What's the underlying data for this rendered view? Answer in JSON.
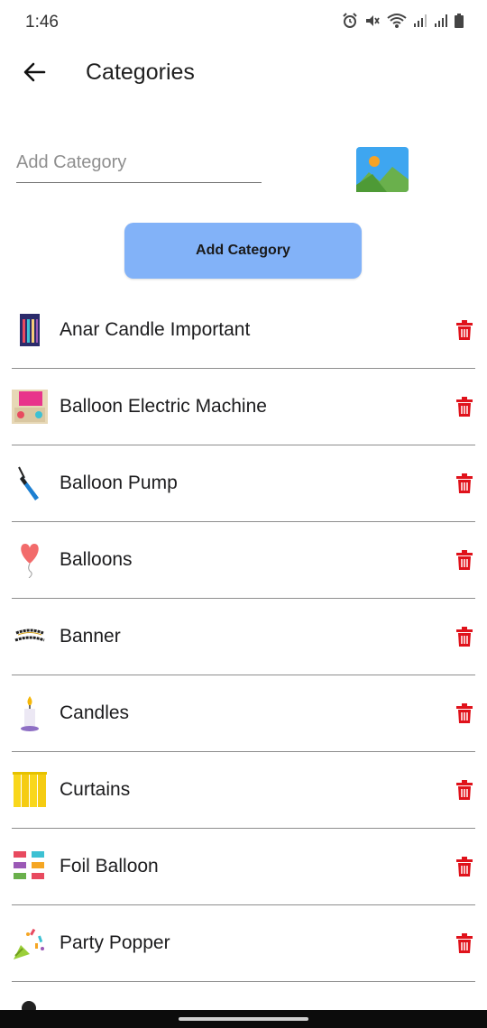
{
  "status": {
    "time": "1:46"
  },
  "appbar": {
    "title": "Categories"
  },
  "form": {
    "placeholder": "Add Category",
    "value": "",
    "button_label": "Add Category"
  },
  "categories": [
    {
      "name": "Anar Candle Important",
      "thumb": "candle-pack"
    },
    {
      "name": "Balloon Electric Machine",
      "thumb": "machine-box"
    },
    {
      "name": "Balloon Pump",
      "thumb": "pump"
    },
    {
      "name": "Balloons",
      "thumb": "balloon"
    },
    {
      "name": "Banner",
      "thumb": "banner"
    },
    {
      "name": "Candles",
      "thumb": "candle"
    },
    {
      "name": "Curtains",
      "thumb": "curtain"
    },
    {
      "name": "Foil Balloon",
      "thumb": "foil"
    },
    {
      "name": "Party Popper",
      "thumb": "popper"
    }
  ],
  "colors": {
    "button": "#82b2f8",
    "delete": "#e0121b",
    "divider": "#8d8d8d"
  }
}
